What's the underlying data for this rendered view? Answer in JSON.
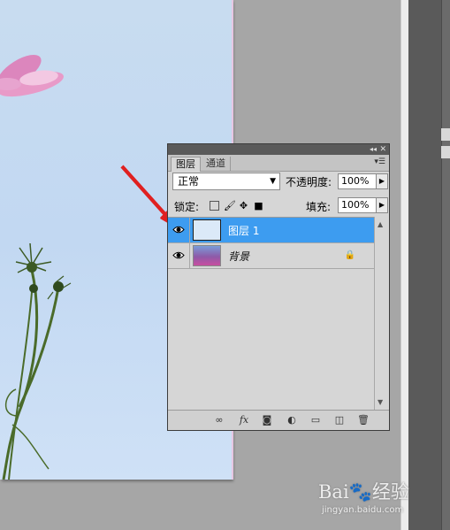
{
  "panel": {
    "tabs": [
      {
        "label": "图层"
      },
      {
        "label": "通道"
      }
    ],
    "blend_mode": "正常",
    "opacity_label": "不透明度:",
    "opacity_value": "100%",
    "lock_label": "锁定:",
    "fill_label": "填充:",
    "fill_value": "100%",
    "layers": [
      {
        "name": "图层 1",
        "selected": true,
        "visible": true,
        "locked": false
      },
      {
        "name": "背景",
        "selected": false,
        "visible": true,
        "locked": true
      }
    ]
  },
  "watermark": {
    "brand": "Bai",
    "brand2": "经验",
    "url": "jingyan.baidu.com"
  },
  "colors": {
    "selection": "#3d9cf0",
    "annotation_arrow": "#e02020"
  }
}
